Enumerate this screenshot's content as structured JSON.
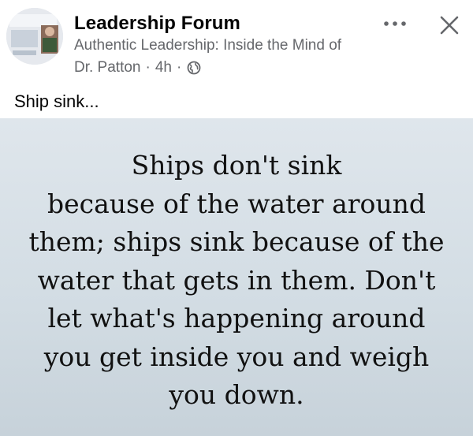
{
  "post": {
    "group_name": "Leadership Forum",
    "title": "Authentic Leadership: Inside the Mind of",
    "author": "Dr. Patton",
    "time": "4h",
    "separator": "·",
    "text": "Ship sink...",
    "more_label": "•••",
    "close_label": "✕",
    "privacy_icon": "globe-icon"
  },
  "image": {
    "quote_lines": [
      "Ships don't sink",
      "because of the water around",
      "them; ships sink because of the",
      "water that gets in them. Don't",
      "let what's happening around",
      "you get inside you and weigh",
      "you down."
    ]
  },
  "colors": {
    "secondary_text": "#65676b",
    "primary_text": "#050505",
    "image_bg": "#d6dfe6"
  }
}
